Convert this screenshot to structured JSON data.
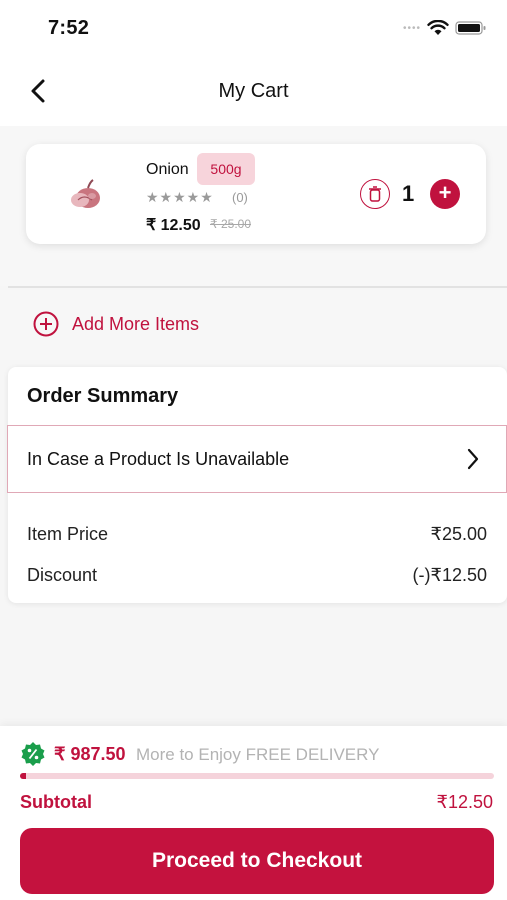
{
  "status_bar": {
    "time": "7:52",
    "icons": [
      "signal-dots",
      "wifi-icon",
      "battery-icon"
    ]
  },
  "header": {
    "title": "My Cart",
    "back_icon": "chevron-left-icon"
  },
  "cart": {
    "items": [
      {
        "name": "Onion",
        "weight": "500g",
        "rating_stars": "★★★★★",
        "rating_count": "(0)",
        "price": "₹ 12.50",
        "original_price": "₹ 25.00",
        "quantity": "1",
        "image_icon": "onion-icon"
      }
    ]
  },
  "add_more": {
    "label": "Add More Items",
    "icon": "plus-circle-icon"
  },
  "order_summary": {
    "title": "Order Summary",
    "unavailable_label": "In Case a Product Is Unavailable",
    "lines": [
      {
        "label": "Item Price",
        "value": "₹25.00"
      },
      {
        "label": "Discount",
        "value": "(-)₹12.50"
      }
    ]
  },
  "delivery": {
    "amount_remaining": "₹ 987.50",
    "message": "More to Enjoy FREE DELIVERY",
    "progress_fraction": 0.0125,
    "badge_icon": "percent-badge-icon"
  },
  "subtotal": {
    "label": "Subtotal",
    "value": "₹12.50"
  },
  "checkout": {
    "label": "Proceed to Checkout"
  },
  "colors": {
    "accent": "#c0123e",
    "badge_bg": "#f7d4db",
    "discount_green": "#1a9e4b"
  }
}
